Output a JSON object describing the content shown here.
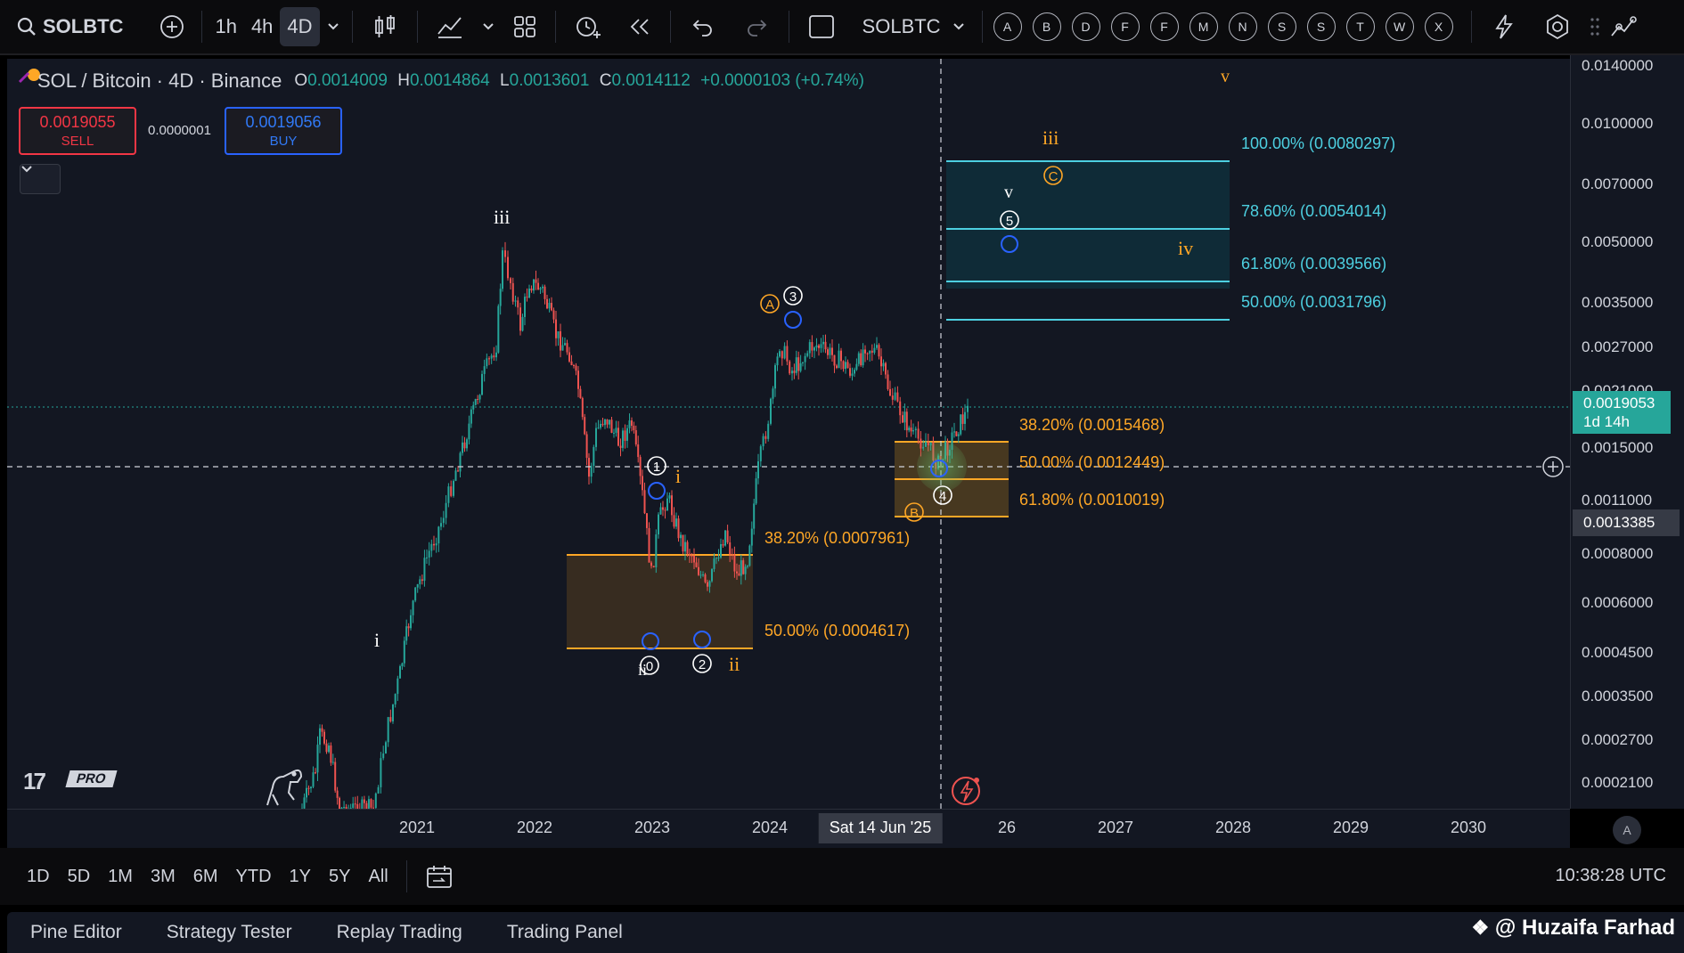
{
  "toolbar": {
    "symbol": "SOLBTC",
    "timeframes": [
      "1h",
      "4h",
      "4D"
    ],
    "active_timeframe": "4D",
    "compare_symbol": "SOLBTC",
    "letter_buttons": [
      "A",
      "B",
      "D",
      "F",
      "F",
      "M",
      "N",
      "S",
      "S",
      "T",
      "W",
      "X"
    ],
    "icons": [
      "search-icon",
      "add-symbol-icon",
      "chevron-down-icon",
      "candles-icon",
      "indicators-icon",
      "layouts-icon",
      "alert-icon",
      "replay-icon",
      "undo-icon",
      "redo-icon",
      "square-icon",
      "flash-icon",
      "settings-icon"
    ]
  },
  "legend": {
    "pair": "SOL / Bitcoin · 4D · Binance",
    "open_label": "O",
    "open": "0.0014009",
    "high_label": "H",
    "high": "0.0014864",
    "low_label": "L",
    "low": "0.0013601",
    "close_label": "C",
    "close": "0.0014112",
    "change": "+0.0000103 (+0.74%)"
  },
  "trade": {
    "sell_price": "0.0019055",
    "sell_label": "SELL",
    "spread": "0.0000001",
    "buy_price": "0.0019056",
    "buy_label": "BUY"
  },
  "price_axis": {
    "ticks": [
      "0.0140000",
      "0.0100000",
      "0.0070000",
      "0.0050000",
      "0.0035000",
      "0.0027000",
      "0.0021000",
      "0.0015000",
      "0.0011000",
      "0.0008000",
      "0.0006000",
      "0.0004500",
      "0.0003500",
      "0.0002700",
      "0.0002100"
    ],
    "last_price": "0.0019053",
    "countdown": "1d 14h",
    "crosshair_price": "0.0013385"
  },
  "time_axis": {
    "ticks": [
      "2021",
      "2022",
      "2023",
      "2024",
      "2",
      "26",
      "2027",
      "2028",
      "2029",
      "2030"
    ],
    "crosshair_date": "Sat 14 Jun '25",
    "auto_label": "A"
  },
  "fib_upper": [
    {
      "label": "100.00% (0.0080297)"
    },
    {
      "label": "78.60% (0.0054014)"
    },
    {
      "label": "61.80% (0.0039566)"
    },
    {
      "label": "50.00% (0.0031796)"
    }
  ],
  "fib_mid": [
    {
      "label": "38.20% (0.0015468)"
    },
    {
      "label": "50.00% (0.0012449)"
    },
    {
      "label": "61.80% (0.0010019)"
    }
  ],
  "fib_lower": [
    {
      "label": "38.20% (0.0007961)"
    },
    {
      "label": "50.00% (0.0004617)"
    }
  ],
  "wave_labels": {
    "white_i": "i",
    "white_iii": "iii",
    "white_v": "v",
    "white_ii": "ii",
    "orange_i": "i",
    "orange_ii": "ii",
    "orange_iii": "iii",
    "orange_iv": "iv",
    "orange_v": "v",
    "circ_0": "0",
    "circ_1": "1",
    "circ_2": "2",
    "circ_3": "3",
    "circ_4": "4",
    "circ_5": "5",
    "circ_A": "A",
    "circ_B": "B",
    "circ_C": "C"
  },
  "range_bar": {
    "ranges": [
      "1D",
      "5D",
      "1M",
      "3M",
      "6M",
      "YTD",
      "1Y",
      "5Y",
      "All"
    ],
    "clock": "10:38:28 UTC"
  },
  "tabs": [
    "Pine Editor",
    "Strategy Tester",
    "Replay Trading",
    "Trading Panel"
  ],
  "watermark": "@ Huzaifa Farhad",
  "logo": {
    "pro": "PRO"
  },
  "colors": {
    "up": "#26a69a",
    "down": "#ef5350",
    "fib_cyan": "#4dd0e1",
    "fib_orange": "#ffa726",
    "background": "#131722"
  }
}
